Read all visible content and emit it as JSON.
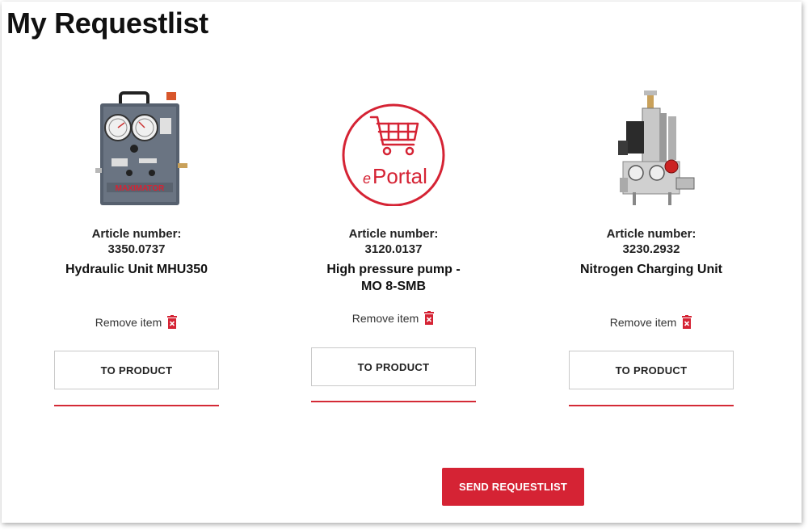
{
  "page": {
    "title": "My Requestlist"
  },
  "items": [
    {
      "article_label": "Article number:",
      "article_number": "3350.0737",
      "name": "Hydraulic Unit MHU350",
      "remove_label": "Remove item",
      "button_label": "TO PRODUCT",
      "image_brand_text": "MAXIMATOR"
    },
    {
      "article_label": "Article number:",
      "article_number": "3120.0137",
      "name_line1": "High pressure pump -",
      "name_line2": "MO 8-SMB",
      "remove_label": "Remove item",
      "button_label": "TO PRODUCT",
      "image_logo_text": "Portal",
      "image_logo_letter": "e"
    },
    {
      "article_label": "Article number:",
      "article_number": "3230.2932",
      "name": "Nitrogen Charging Unit",
      "remove_label": "Remove item",
      "button_label": "TO PRODUCT"
    }
  ],
  "send_button_label": "SEND REQUESTLIST",
  "colors": {
    "accent": "#d52334",
    "divider": "#d42a36"
  }
}
